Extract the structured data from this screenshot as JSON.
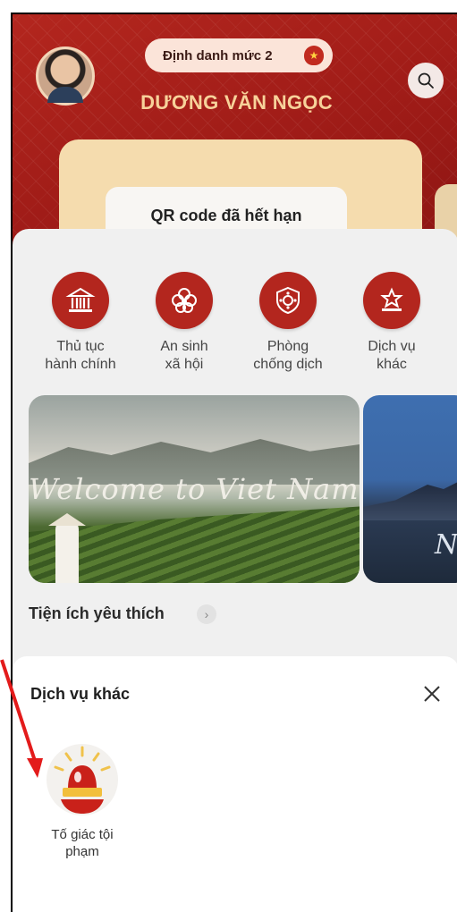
{
  "header": {
    "level_badge": "Định danh mức 2",
    "user_name": "DƯƠNG VĂN NGỌC"
  },
  "card": {
    "qr_status": "QR code đã hết hạn"
  },
  "services": [
    {
      "label": "Thủ tục\nhành chính",
      "icon": "building-icon"
    },
    {
      "label": "An sinh\nxã hội",
      "icon": "flower-icon"
    },
    {
      "label": "Phòng\nchống dịch",
      "icon": "virus-shield-icon"
    },
    {
      "label": "Dịch vụ\nkhác",
      "icon": "more-services-icon"
    }
  ],
  "banner": {
    "caption": "Welcome to Viet Nam",
    "caption_2": "N"
  },
  "favorites": {
    "title": "Tiện ích yêu thích",
    "more_icon": "chevron-right-icon"
  },
  "sheet": {
    "title": "Dịch vụ khác",
    "items": [
      {
        "label": "Tố giác tội\nphạm",
        "icon": "siren-icon"
      }
    ]
  },
  "colors": {
    "brand_red": "#b3261e",
    "gold": "#f7d29a",
    "annotation_red": "#e31b1b"
  }
}
